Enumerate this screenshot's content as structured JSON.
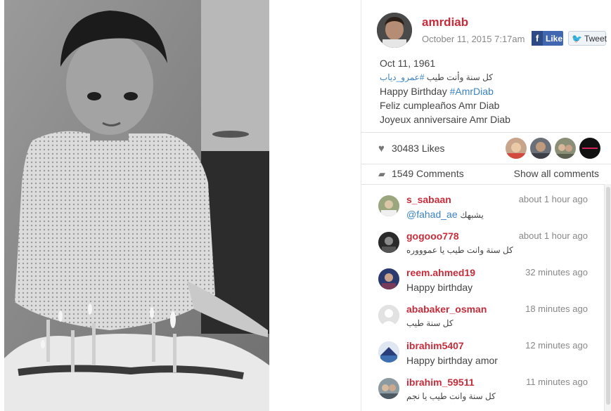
{
  "post": {
    "username": "amrdiab",
    "date": "October 11, 2015 7:17am",
    "caption": {
      "line1": "Oct 11, 1961",
      "line2_text": "كل سنة وأنت طيب ",
      "line2_tag": "#عمرو_دياب",
      "line3_text": "Happy Birthday ",
      "line3_tag": "#AmrDiab",
      "line4": "Feliz cumpleaños Amr Diab",
      "line5": "Joyeux anniversaire Amr Diab"
    }
  },
  "share": {
    "like_label": "Like",
    "like_icon": "f",
    "tweet_label": "Tweet",
    "tweet_icon": "🐦"
  },
  "likes": {
    "count_label": "30483 Likes",
    "heart_icon": "♥"
  },
  "comments_summary": {
    "count_label": "1549 Comments",
    "show_all_label": "Show all comments",
    "comment_icon": "▰"
  },
  "comments": [
    {
      "user": "s_sabaan",
      "time": "about 1 hour ago",
      "text": "يشبهك ",
      "mention": "@fahad_ae",
      "arabic": false
    },
    {
      "user": "gogooo778",
      "time": "about 1 hour ago",
      "text": "كل سنة وانت طيب يا عموووره",
      "arabic": true
    },
    {
      "user": "reem.ahmed19",
      "time": "32 minutes ago",
      "text": "Happy birthday",
      "arabic": false
    },
    {
      "user": "ababaker_osman",
      "time": "18 minutes ago",
      "text": "كل سنة طيب",
      "arabic": true
    },
    {
      "user": "ibrahim5407",
      "time": "12 minutes ago",
      "text": "Happy birthday amor",
      "arabic": false
    },
    {
      "user": "ibrahim_59511",
      "time": "11 minutes ago",
      "text": "كل سنة وانت طيب يا نجم",
      "arabic": true
    }
  ],
  "colors": {
    "username": "#c62c3a",
    "hashtag": "#3b83c4",
    "facebook": "#4267b2"
  }
}
